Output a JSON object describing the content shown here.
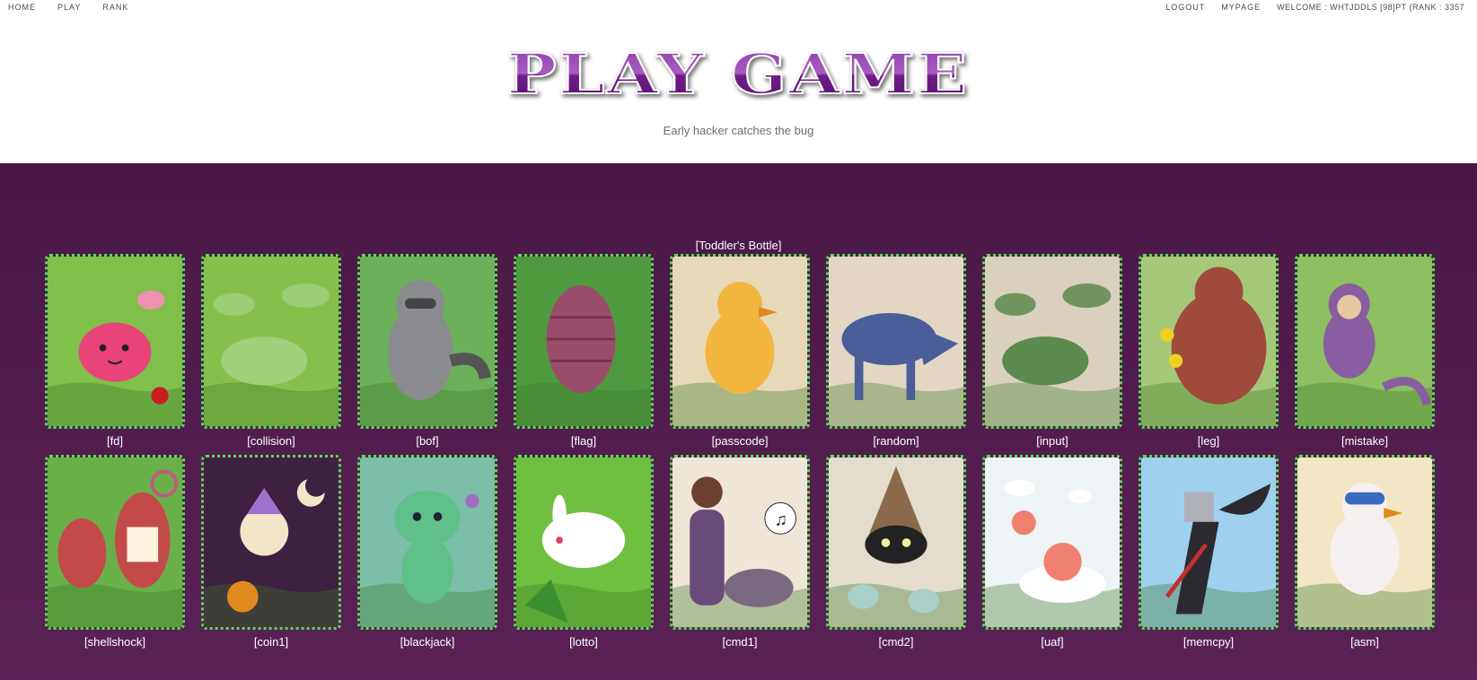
{
  "nav": {
    "home": "HOME",
    "play": "PLAY",
    "rank": "RANK",
    "logout": "LOGOUT",
    "mypage": "MYPAGE",
    "welcome": "WELCOME : WHTJDDLS [98]PT (RANK : 3357"
  },
  "header": {
    "title": "PLAY GAME",
    "subtitle": "Early hacker catches the bug"
  },
  "section": {
    "title": "[Toddler's Bottle]"
  },
  "games": [
    {
      "label": "[fd]",
      "bg": "#7fbf4a",
      "fg": "#e8447a",
      "shape": "blob"
    },
    {
      "label": "[collision]",
      "bg": "#86c04c",
      "fg": "#9fd07a",
      "shape": "bug"
    },
    {
      "label": "[bof]",
      "bg": "#6db05a",
      "fg": "#8a8c90",
      "shape": "raccoon"
    },
    {
      "label": "[flag]",
      "bg": "#4f9a3e",
      "fg": "#9a4d6a",
      "shape": "hive"
    },
    {
      "label": "[passcode]",
      "bg": "#e7d8b8",
      "fg": "#f2b640",
      "shape": "bird"
    },
    {
      "label": "[random]",
      "bg": "#e3d7c4",
      "fg": "#4a5f99",
      "shape": "wolf"
    },
    {
      "label": "[input]",
      "bg": "#d9d1bd",
      "fg": "#5d8a4e",
      "shape": "bug"
    },
    {
      "label": "[leg]",
      "bg": "#a5c878",
      "fg": "#a04a3c",
      "shape": "bear"
    },
    {
      "label": "[mistake]",
      "bg": "#8cc060",
      "fg": "#8a5da0",
      "shape": "monkey"
    },
    {
      "label": "[shellshock]",
      "bg": "#6ab048",
      "fg": "#c44a4a",
      "shape": "plant"
    },
    {
      "label": "[coin1]",
      "bg": "#3e2040",
      "fg": "#f2e6c8",
      "shape": "ghost"
    },
    {
      "label": "[blackjack]",
      "bg": "#7bbfa8",
      "fg": "#5fc08a",
      "shape": "lizard"
    },
    {
      "label": "[lotto]",
      "bg": "#6fc040",
      "fg": "#ffffff",
      "shape": "bunny"
    },
    {
      "label": "[cmd1]",
      "bg": "#f0e6d8",
      "fg": "#6a4a7a",
      "shape": "girl"
    },
    {
      "label": "[cmd2]",
      "bg": "#e4dccc",
      "fg": "#8a6a4a",
      "shape": "hermit"
    },
    {
      "label": "[uaf]",
      "bg": "#eef4f6",
      "fg": "#f08070",
      "shape": "cloud"
    },
    {
      "label": "[memcpy]",
      "bg": "#9fd0ee",
      "fg": "#2a2a30",
      "shape": "knight"
    },
    {
      "label": "[asm]",
      "bg": "#f2e6c4",
      "fg": "#f4f0f0",
      "shape": "bird2"
    }
  ],
  "colors": {
    "accent_purple": "#5a2256",
    "card_border": "#54e052",
    "title_purple": "#8e3fa8"
  }
}
